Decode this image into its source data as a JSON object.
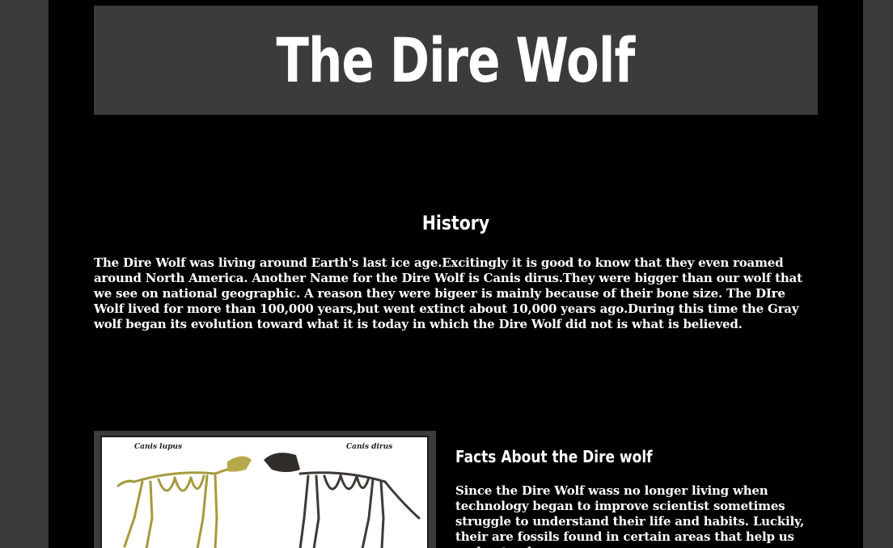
{
  "header": {
    "title": "The Dire Wolf"
  },
  "history": {
    "heading": "History",
    "body": "The Dire Wolf was living around Earth's last ice age.Excitingly it is good to know that they even roamed around North America. Another Name for the Dire Wolf is Canis dirus.They were bigger than our wolf that we see on national geographic. A reason they were bigeer is mainly because of their bone size. The DIre Wolf lived for more than 100,000 years,but went extinct about 10,000 years ago.During this time the Gray wolf began its evolution toward what it is today in which the Dire Wolf did not is what is believed."
  },
  "figure": {
    "label_left": "Canis lupus",
    "label_right": "Canis dirus"
  },
  "facts": {
    "heading": "Facts About the Dire wolf",
    "body": "Since the Dire Wolf wass no longer living when technology began to improve scientist sometimes struggle to understand their life and habits. Luckily, their are fossils found in certain areas that help us understand"
  },
  "colors": {
    "background": "#3a3a3a",
    "page": "#000000",
    "header_band": "#3b3b3b",
    "text": "#ffffff"
  }
}
